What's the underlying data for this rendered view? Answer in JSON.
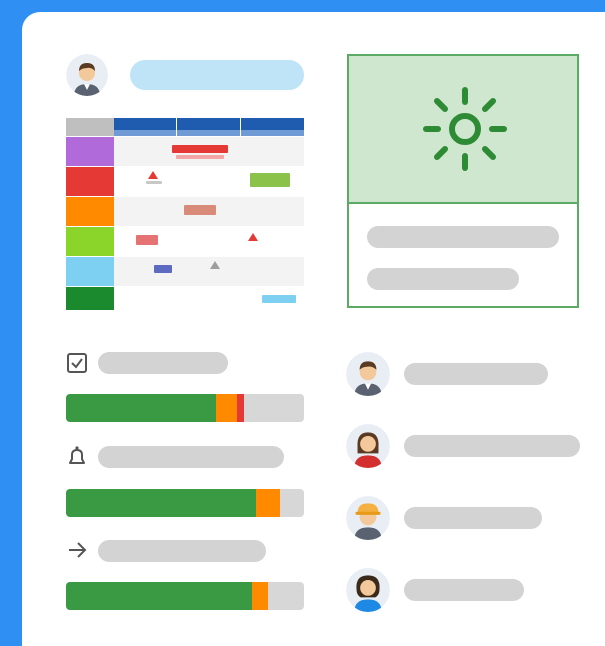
{
  "colors": {
    "background": "#2f8ff2",
    "card": "#ffffff",
    "placeholder": "#d3d3d3",
    "progress_green": "#3a9a44",
    "progress_orange": "#ff8a00",
    "progress_red": "#e53935",
    "weather_bg": "#cfe7cf",
    "weather_border": "#5cab65",
    "sun": "#2e8b35"
  },
  "header": {
    "avatar_icon": "person-man-icon",
    "title_placeholder_color": "#bfe3f7"
  },
  "schedule": {
    "columns": 3,
    "rows": [
      {
        "label_color": "#b06ad9"
      },
      {
        "label_color": "#e53935"
      },
      {
        "label_color": "#ff8a00"
      },
      {
        "label_color": "#8bd52a"
      },
      {
        "label_color": "#7ed0f2"
      },
      {
        "label_color": "#1b8a2f"
      }
    ]
  },
  "tasks": [
    {
      "icon": "checkbox-icon",
      "progress": {
        "green": 0.63,
        "orange": 0.09,
        "red": 0.03
      }
    },
    {
      "icon": "bell-icon",
      "progress": {
        "green": 0.8,
        "orange": 0.1,
        "red": 0
      }
    },
    {
      "icon": "arrow-right-icon",
      "progress": {
        "green": 0.78,
        "orange": 0.07,
        "red": 0
      }
    }
  ],
  "weather": {
    "icon": "sun-icon"
  },
  "people": [
    {
      "avatar": "person-man-icon"
    },
    {
      "avatar": "person-woman-icon"
    },
    {
      "avatar": "person-construction-worker-icon"
    },
    {
      "avatar": "person-woman-curly-icon"
    }
  ]
}
